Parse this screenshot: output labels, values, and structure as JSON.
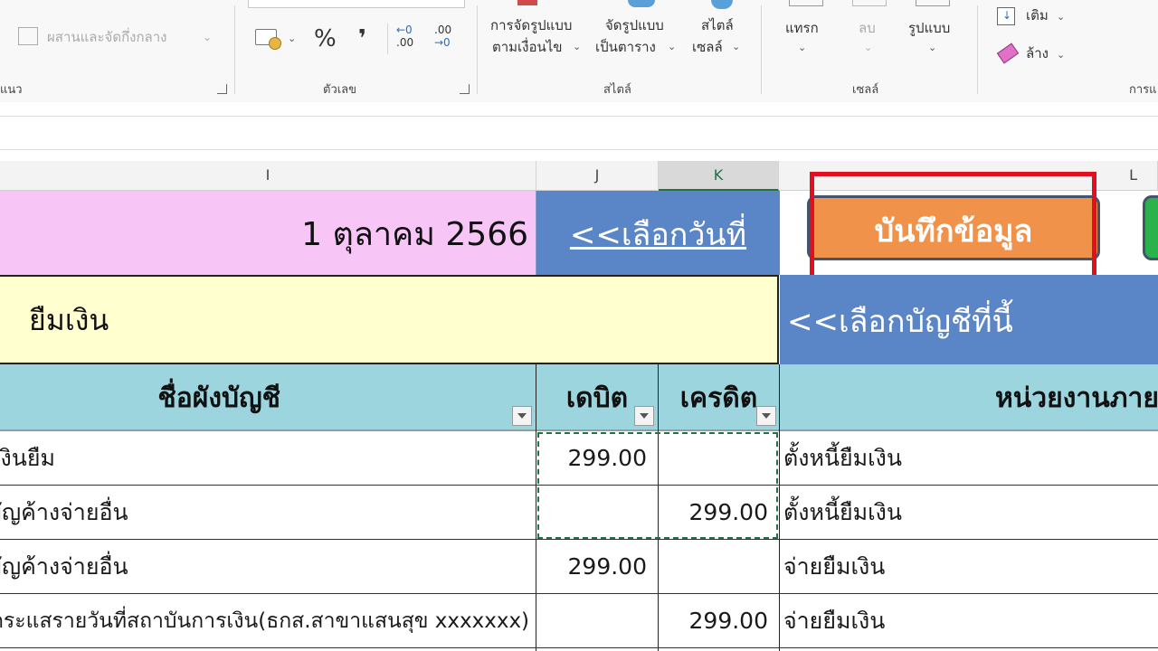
{
  "ribbon": {
    "alignment": {
      "merge_label": "ผสานและจัดกึ่งกลาง",
      "group_label": "แนว"
    },
    "number": {
      "percent": "%",
      "comma": "❜",
      "inc_decimal": "←0\n.00",
      "dec_decimal": ".00\n→0",
      "group_label": "ตัวเลข"
    },
    "styles": {
      "conditional_line1": "การจัดรูปแบบ",
      "conditional_line2": "ตามเงื่อนไข",
      "as_table_line1": "จัดรูปแบบ",
      "as_table_line2": "เป็นตาราง",
      "cell_styles_line1": "สไตล์",
      "cell_styles_line2": "เซลล์",
      "group_label": "สไตล์"
    },
    "cells": {
      "insert": "แทรก",
      "delete": "ลบ",
      "format": "รูปแบบ",
      "group_label": "เซลล์"
    },
    "editing": {
      "fill": "เติม",
      "clear": "ล้าง",
      "group_label": "การแ"
    }
  },
  "columns": [
    "I",
    "J",
    "K",
    "L"
  ],
  "sheet": {
    "date_value": "1 ตุลาคม 2566",
    "choose_date_link": "<<เลือกวันที่",
    "save_button": "บันทึกข้อมูล",
    "account_value": "ยืมเงิน",
    "choose_account_link": "<<เลือกบัญชีที่นี้",
    "headers": {
      "account_name": "ชื่อผังบัญชี",
      "debit": "เดบิต",
      "credit": "เครดิต",
      "unit": "หน่วยงานภาย"
    },
    "rows": [
      {
        "account": "เงินยืม",
        "debit": "299.00",
        "credit": "",
        "description": "ตั้งหนี้ยืมเงิน"
      },
      {
        "account": "บัญค้างจ่ายอื่น",
        "debit": "",
        "credit": "299.00",
        "description": "ตั้งหนี้ยืมเงิน"
      },
      {
        "account": "บัญค้างจ่ายอื่น",
        "debit": "299.00",
        "credit": "",
        "description": "จ่ายยืมเงิน"
      },
      {
        "account": "กระแสรายวันที่สถาบันการเงิน(ธกส.สาขาแสนสุข xxxxxxx)",
        "debit": "",
        "credit": "299.00",
        "description": "จ่ายยืมเงิน"
      }
    ]
  },
  "colors": {
    "pink": "#f7c6f7",
    "blue_header": "#5a86c7",
    "yellow": "#ffffd0",
    "teal_header": "#9dd5df",
    "orange_button": "#f0924a",
    "highlight_red": "#e01020",
    "green": "#2bb24c"
  }
}
